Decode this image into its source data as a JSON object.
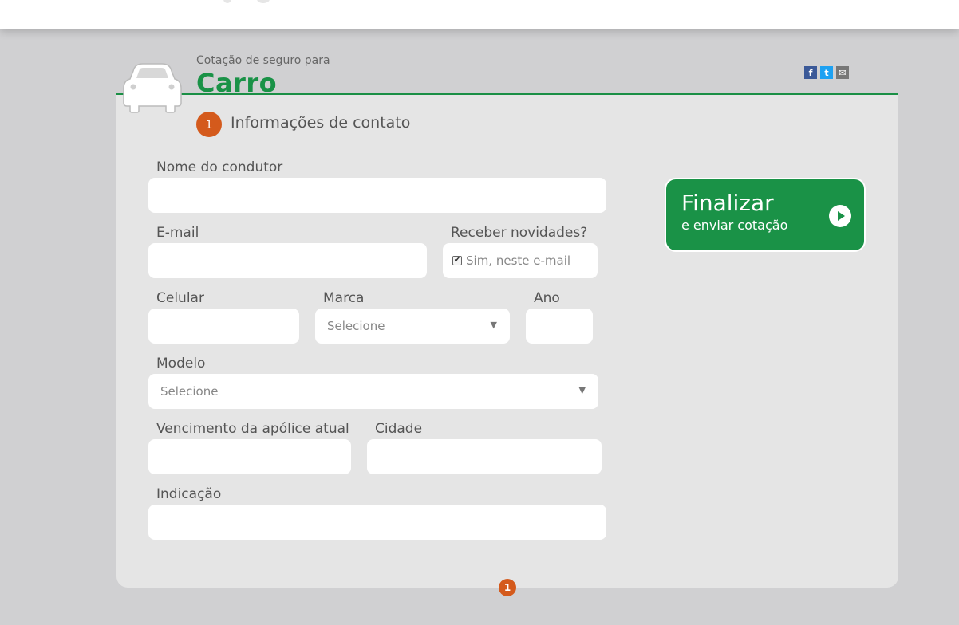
{
  "header": {
    "subtitle": "Cotação de seguro para",
    "title": "Carro"
  },
  "share": {
    "facebook": "f",
    "twitter": "t",
    "email": "✉"
  },
  "step": {
    "number": "1",
    "title": "Informações de contato"
  },
  "form": {
    "nome_label": "Nome do condutor",
    "email_label": "E-mail",
    "novidades_label": "Receber novidades?",
    "novidades_option": "Sim, neste e-mail",
    "novidades_checked": true,
    "celular_label": "Celular",
    "marca_label": "Marca",
    "marca_value": "Selecione",
    "ano_label": "Ano",
    "modelo_label": "Modelo",
    "modelo_value": "Selecione",
    "vencimento_label": "Vencimento da apólice atual",
    "cidade_label": "Cidade",
    "indicacao_label": "Indicação"
  },
  "finalize": {
    "title": "Finalizar",
    "subtitle": "e enviar cotação"
  },
  "pager": {
    "current": "1"
  },
  "colors": {
    "brand_green": "#1a9247",
    "step_orange": "#d45a1c",
    "background": "#d0d0d2",
    "card": "#e5e5e5"
  },
  "icons": {
    "header": "car-icon",
    "finalize": "play-icon"
  }
}
